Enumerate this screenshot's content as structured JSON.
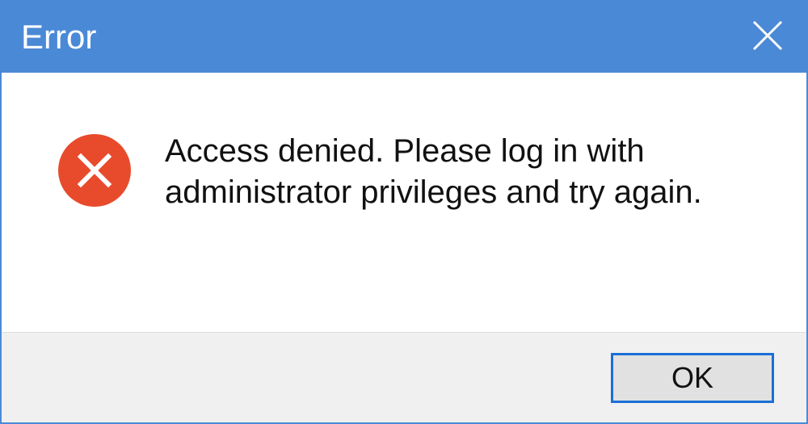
{
  "dialog": {
    "title": "Error",
    "message": "Access denied. Please log in with administrator privileges and try again.",
    "ok_label": "OK"
  }
}
